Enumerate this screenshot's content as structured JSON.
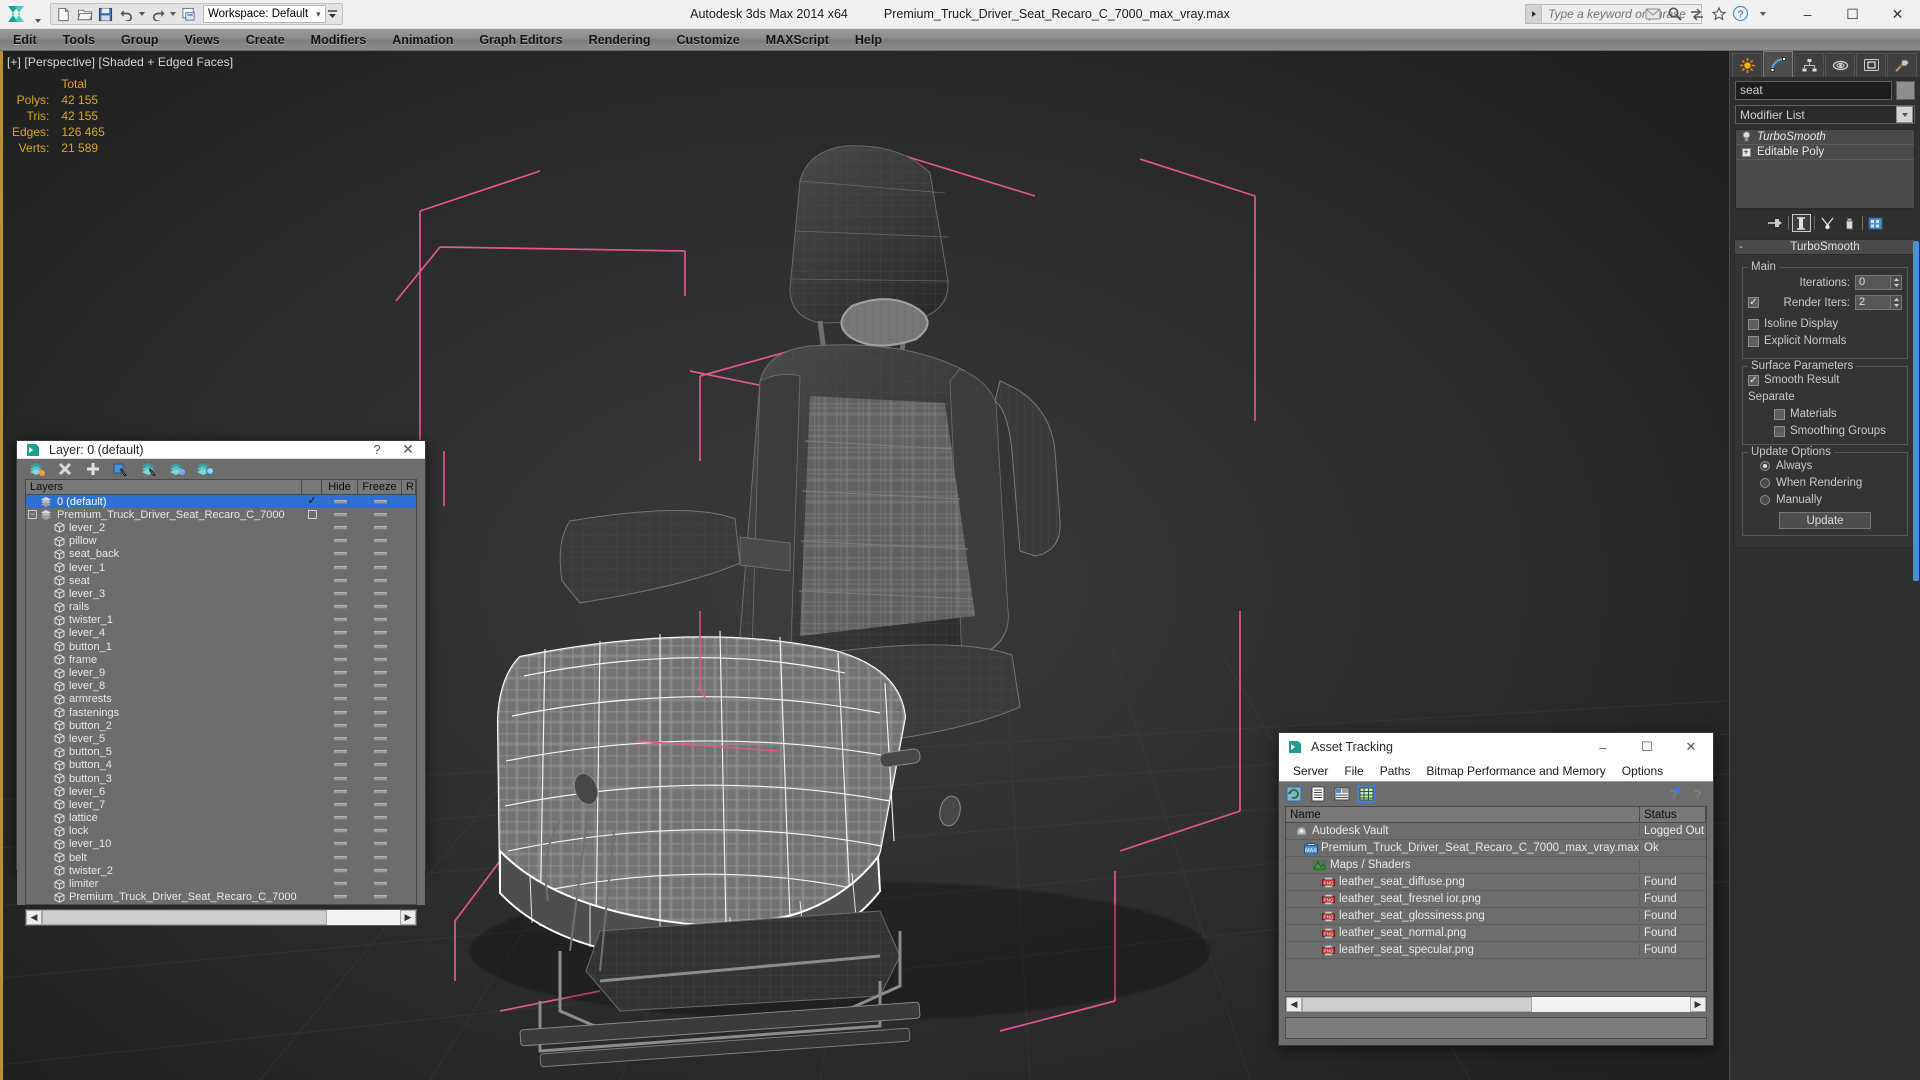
{
  "app": {
    "title_product": "Autodesk 3ds Max  2014 x64",
    "title_file": "Premium_Truck_Driver_Seat_Recaro_C_7000_max_vray.max"
  },
  "quick_access": {
    "workspace_label": "Workspace: Default",
    "buttons": [
      {
        "name": "new-file-icon",
        "tip": "New"
      },
      {
        "name": "open-file-icon",
        "tip": "Open"
      },
      {
        "name": "save-file-icon",
        "tip": "Save"
      },
      {
        "name": "undo-icon",
        "tip": "Undo"
      },
      {
        "name": "redo-icon",
        "tip": "Redo"
      },
      {
        "name": "project-folder-icon",
        "tip": "Set Project Folder"
      }
    ]
  },
  "search": {
    "placeholder": "Type a keyword or phrase"
  },
  "window_controls": {
    "minimize": "–",
    "maximize": "☐",
    "close": "✕"
  },
  "menu": {
    "items": [
      "Edit",
      "Tools",
      "Group",
      "Views",
      "Create",
      "Modifiers",
      "Animation",
      "Graph Editors",
      "Rendering",
      "Customize",
      "MAXScript",
      "Help"
    ]
  },
  "viewport": {
    "label": "[+] [Perspective] [Shaded + Edged Faces]",
    "stats": {
      "header": "Total",
      "rows": [
        {
          "label": "Polys:",
          "value": "42 155"
        },
        {
          "label": "Tris:",
          "value": "42 155"
        },
        {
          "label": "Edges:",
          "value": "126 465"
        },
        {
          "label": "Verts:",
          "value": "21 589"
        }
      ]
    },
    "accent_color": "#d9a823",
    "selection_color": "#ffffff",
    "gizmo_color": "#e0558a"
  },
  "layer_dialog": {
    "title": "Layer: 0 (default)",
    "help_glyph": "?",
    "close_glyph": "✕",
    "toolbar": [
      {
        "name": "create-new-layer-icon"
      },
      {
        "name": "delete-highlighted-layer-icon"
      },
      {
        "name": "add-selected-objects-icon"
      },
      {
        "name": "select-objects-in-layer-icon"
      },
      {
        "name": "select-highlighted-layers-icon"
      },
      {
        "name": "highlight-selected-objects-layers-icon"
      },
      {
        "name": "layer-properties-icon"
      }
    ],
    "columns": [
      "Layers",
      "",
      "Hide",
      "Freeze",
      "R"
    ],
    "rows": [
      {
        "name": "0 (default)",
        "type": "layer",
        "indent": 1,
        "selected": true,
        "current": true,
        "expander": false
      },
      {
        "name": "Premium_Truck_Driver_Seat_Recaro_C_7000",
        "type": "layer",
        "indent": 0,
        "selected": false,
        "current": false,
        "expander": true
      },
      {
        "name": "lever_2",
        "type": "object",
        "indent": 2
      },
      {
        "name": "pillow",
        "type": "object",
        "indent": 2
      },
      {
        "name": "seat_back",
        "type": "object",
        "indent": 2
      },
      {
        "name": "lever_1",
        "type": "object",
        "indent": 2
      },
      {
        "name": "seat",
        "type": "object",
        "indent": 2
      },
      {
        "name": "lever_3",
        "type": "object",
        "indent": 2
      },
      {
        "name": "rails",
        "type": "object",
        "indent": 2
      },
      {
        "name": "twister_1",
        "type": "object",
        "indent": 2
      },
      {
        "name": "lever_4",
        "type": "object",
        "indent": 2
      },
      {
        "name": "button_1",
        "type": "object",
        "indent": 2
      },
      {
        "name": "frame",
        "type": "object",
        "indent": 2
      },
      {
        "name": "lever_9",
        "type": "object",
        "indent": 2
      },
      {
        "name": "lever_8",
        "type": "object",
        "indent": 2
      },
      {
        "name": "armrests",
        "type": "object",
        "indent": 2
      },
      {
        "name": "fastenings",
        "type": "object",
        "indent": 2
      },
      {
        "name": "button_2",
        "type": "object",
        "indent": 2
      },
      {
        "name": "lever_5",
        "type": "object",
        "indent": 2
      },
      {
        "name": "button_5",
        "type": "object",
        "indent": 2
      },
      {
        "name": "button_4",
        "type": "object",
        "indent": 2
      },
      {
        "name": "button_3",
        "type": "object",
        "indent": 2
      },
      {
        "name": "lever_6",
        "type": "object",
        "indent": 2
      },
      {
        "name": "lever_7",
        "type": "object",
        "indent": 2
      },
      {
        "name": "lattice",
        "type": "object",
        "indent": 2
      },
      {
        "name": "lock",
        "type": "object",
        "indent": 2
      },
      {
        "name": "lever_10",
        "type": "object",
        "indent": 2
      },
      {
        "name": "belt",
        "type": "object",
        "indent": 2
      },
      {
        "name": "twister_2",
        "type": "object",
        "indent": 2
      },
      {
        "name": "limiter",
        "type": "object",
        "indent": 2
      },
      {
        "name": "Premium_Truck_Driver_Seat_Recaro_C_7000",
        "type": "object",
        "indent": 2
      }
    ]
  },
  "asset_tracking": {
    "title": "Asset Tracking",
    "window_controls": {
      "minimize": "–",
      "maximize": "☐",
      "close": "✕"
    },
    "menu": [
      "Server",
      "File",
      "Paths",
      "Bitmap Performance and Memory",
      "Options"
    ],
    "toolbar": [
      {
        "name": "refresh-icon",
        "active": false
      },
      {
        "name": "list-view-icon",
        "active": false
      },
      {
        "name": "details-view-icon",
        "active": false
      },
      {
        "name": "grid-view-icon",
        "active": true
      },
      {
        "name": "help-new-icon",
        "active": false
      },
      {
        "name": "help-icon",
        "active": false
      }
    ],
    "columns": [
      "Name",
      "Status"
    ],
    "rows": [
      {
        "name": "Autodesk Vault",
        "status": "Logged Out",
        "icon": "vault-icon",
        "indent": 1
      },
      {
        "name": "Premium_Truck_Driver_Seat_Recaro_C_7000_max_vray.max",
        "status": "Ok",
        "icon": "max-file-icon",
        "indent": 2
      },
      {
        "name": "Maps / Shaders",
        "status": "",
        "icon": "maps-shaders-icon",
        "indent": 3
      },
      {
        "name": "leather_seat_diffuse.png",
        "status": "Found",
        "icon": "png-icon",
        "indent": 4
      },
      {
        "name": "leather_seat_fresnel ior.png",
        "status": "Found",
        "icon": "png-icon",
        "indent": 4
      },
      {
        "name": "leather_seat_glossiness.png",
        "status": "Found",
        "icon": "png-icon",
        "indent": 4
      },
      {
        "name": "leather_seat_normal.png",
        "status": "Found",
        "icon": "png-icon",
        "indent": 4
      },
      {
        "name": "leather_seat_specular.png",
        "status": "Found",
        "icon": "png-icon",
        "indent": 4
      }
    ]
  },
  "command_panel": {
    "tabs": [
      {
        "name": "create-tab",
        "active": false
      },
      {
        "name": "modify-tab",
        "active": true
      },
      {
        "name": "hierarchy-tab",
        "active": false
      },
      {
        "name": "motion-tab",
        "active": false
      },
      {
        "name": "display-tab",
        "active": false
      },
      {
        "name": "utilities-tab",
        "active": false
      }
    ],
    "object_name": "seat",
    "modifier_list_label": "Modifier List",
    "stack": [
      {
        "label": "TurboSmooth",
        "italic": true,
        "icon": "lightbulb-icon",
        "expandable": false
      },
      {
        "label": "Editable Poly",
        "italic": false,
        "icon": "",
        "expandable": true
      }
    ],
    "stack_toolbar": [
      {
        "name": "pin-stack-icon",
        "active": false
      },
      {
        "name": "show-end-result-icon",
        "active": true
      },
      {
        "name": "make-unique-icon",
        "active": false
      },
      {
        "name": "remove-modifier-icon",
        "active": false
      },
      {
        "name": "configure-modifier-sets-icon",
        "active": false
      }
    ],
    "rollout": {
      "title": "TurboSmooth",
      "collapse_glyph": "-",
      "groups": [
        {
          "title": "Main",
          "fields": [
            {
              "kind": "spinner",
              "label": "Iterations:",
              "value": "0"
            },
            {
              "kind": "checkbox-spinner",
              "label": "Render Iters:",
              "value": "2",
              "checked": true
            },
            {
              "kind": "checkbox",
              "label": "Isoline Display",
              "checked": false
            },
            {
              "kind": "checkbox",
              "label": "Explicit Normals",
              "checked": false
            }
          ]
        },
        {
          "title": "Surface Parameters",
          "fields": [
            {
              "kind": "checkbox",
              "label": "Smooth Result",
              "checked": true
            },
            {
              "kind": "text",
              "label": "Separate"
            },
            {
              "kind": "checkbox",
              "label": "Materials",
              "checked": false,
              "indent": true
            },
            {
              "kind": "checkbox",
              "label": "Smoothing Groups",
              "checked": false,
              "indent": true
            }
          ]
        },
        {
          "title": "Update Options",
          "fields": [
            {
              "kind": "radio",
              "label": "Always",
              "checked": true
            },
            {
              "kind": "radio",
              "label": "When Rendering",
              "checked": false
            },
            {
              "kind": "radio",
              "label": "Manually",
              "checked": false
            },
            {
              "kind": "button",
              "label": "Update"
            }
          ]
        }
      ]
    }
  }
}
